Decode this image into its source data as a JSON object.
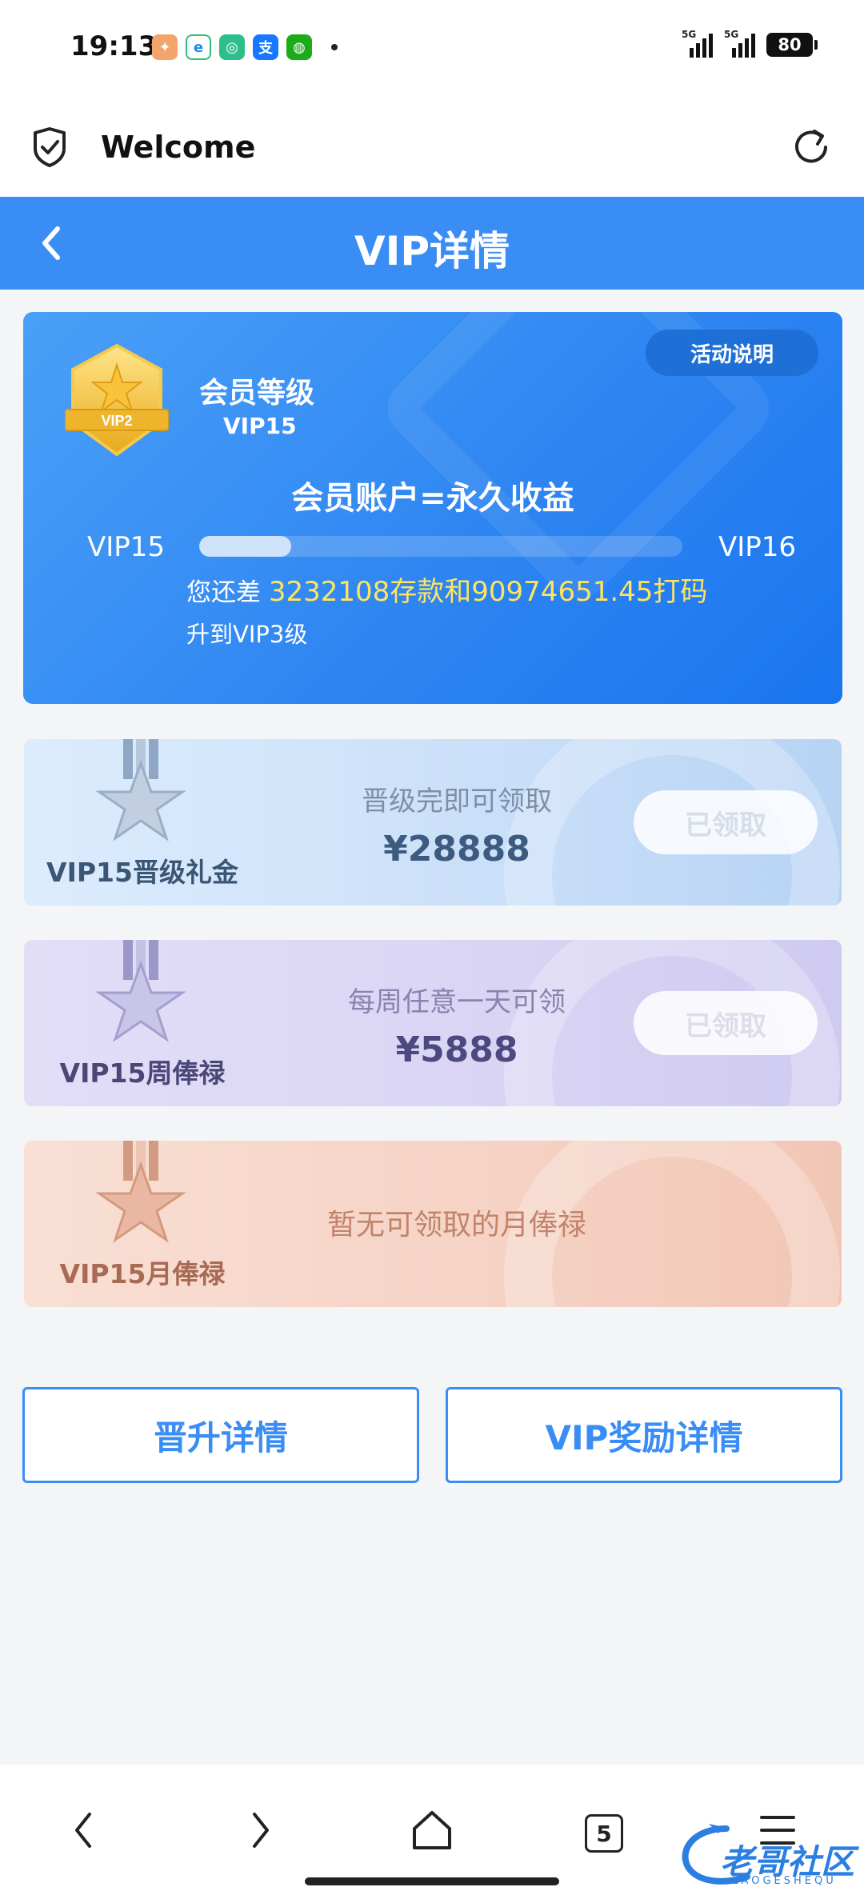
{
  "status_bar": {
    "time": "19:13",
    "signal1_label": "5G",
    "signal2_label": "5G",
    "battery": "80"
  },
  "browser": {
    "title": "Welcome"
  },
  "header": {
    "title": "VIP详情"
  },
  "vip_card": {
    "activity_button": "活动说明",
    "badge_label": "VIP2",
    "level_title": "会员等级",
    "level_value": "VIP15",
    "slogan": "会员账户=永久收益",
    "current_level": "VIP15",
    "next_level": "VIP16",
    "progress": 0.19,
    "remain_prefix": "您还差 ",
    "remain_highlight": "3232108存款和90974651.45打码",
    "upgrade_text": "升到VIP3级"
  },
  "rewards": [
    {
      "name": "VIP15晋级礼金",
      "desc": "晋级完即可领取",
      "amount": "¥28888",
      "button": "已领取"
    },
    {
      "name": "VIP15周俸禄",
      "desc": "每周任意一天可领",
      "amount": "¥5888",
      "button": "已领取"
    },
    {
      "name": "VIP15月俸禄",
      "desc": "暂无可领取的月俸禄"
    }
  ],
  "actions": {
    "promotion_details": "晋升详情",
    "reward_details": "VIP奖励详情"
  },
  "navbar": {
    "tab_count": "5"
  },
  "watermark": {
    "text": "老哥社区",
    "sub": "LAOGESHEQU"
  },
  "colors": {
    "primary": "#3a8df5",
    "highlight": "#ffe45e"
  }
}
